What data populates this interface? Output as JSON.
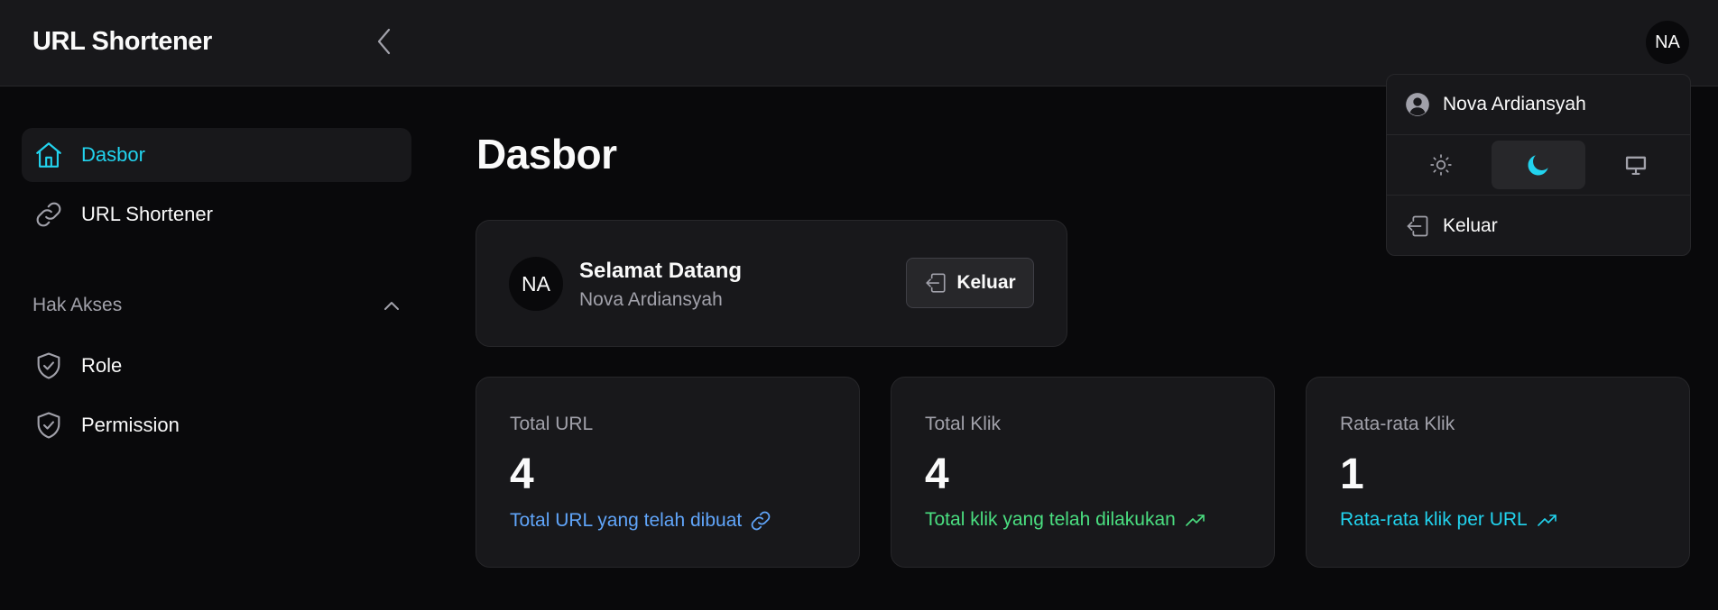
{
  "header": {
    "app_title": "URL Shortener",
    "avatar_initials": "NA"
  },
  "sidebar": {
    "items": [
      {
        "label": "Dasbor",
        "icon": "home-icon",
        "active": true
      },
      {
        "label": "URL Shortener",
        "icon": "link-icon",
        "active": false
      }
    ],
    "section": {
      "label": "Hak Akses",
      "expanded": true,
      "items": [
        {
          "label": "Role",
          "icon": "shield-check-icon"
        },
        {
          "label": "Permission",
          "icon": "shield-check-icon"
        }
      ]
    }
  },
  "main": {
    "page_title": "Dasbor",
    "welcome": {
      "avatar_initials": "NA",
      "greeting": "Selamat Datang",
      "user_name": "Nova Ardiansyah",
      "logout_label": "Keluar"
    },
    "stats": [
      {
        "label": "Total URL",
        "value": "4",
        "description": "Total URL yang telah dibuat",
        "icon": "link-icon",
        "color": "#60a5fa"
      },
      {
        "label": "Total Klik",
        "value": "4",
        "description": "Total klik yang telah dilakukan",
        "icon": "trending-up-icon",
        "color": "#4ade80"
      },
      {
        "label": "Rata-rata Klik",
        "value": "1",
        "description": "Rata-rata klik per URL",
        "icon": "trending-up-icon",
        "color": "#22d3ee"
      }
    ]
  },
  "user_menu": {
    "user_name": "Nova Ardiansyah",
    "theme_options": [
      "light",
      "dark",
      "system"
    ],
    "selected_theme": "dark",
    "logout_label": "Keluar"
  },
  "colors": {
    "accent": "#22d3ee",
    "background": "#09090b",
    "surface": "#18181b",
    "border": "#27272a"
  }
}
